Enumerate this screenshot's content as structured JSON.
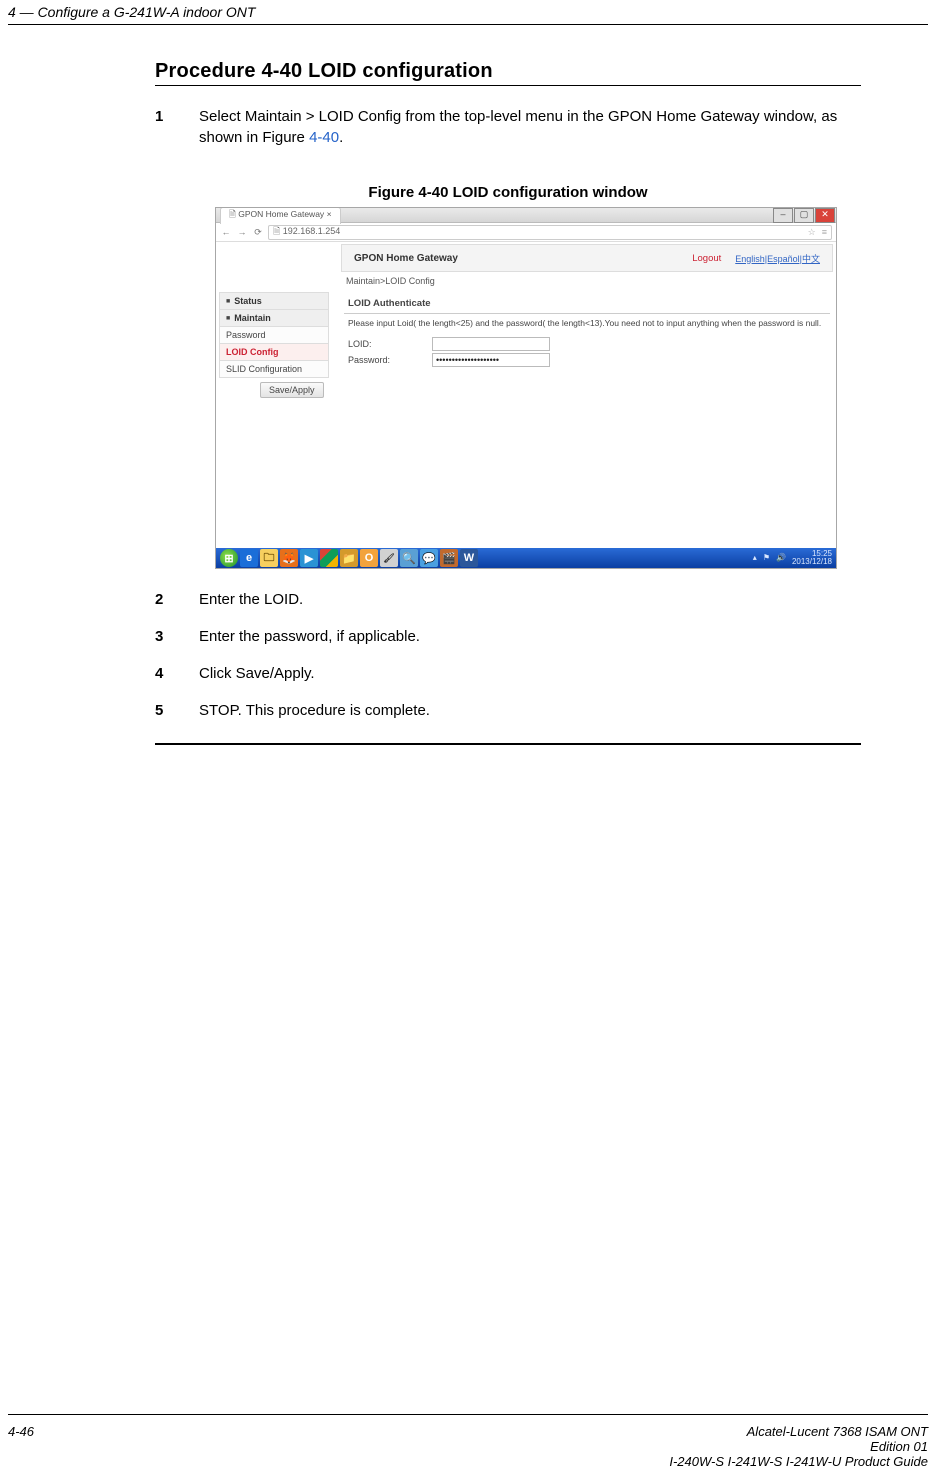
{
  "header": {
    "chapter_label": "4 — Configure a G-241W-A indoor ONT"
  },
  "procedure": {
    "title": "Procedure 4-40  LOID configuration",
    "steps": [
      {
        "num": "1",
        "text_before": "Select Maintain > LOID Config from the top-level menu in the GPON Home Gateway window, as shown in Figure ",
        "figref": "4-40",
        "text_after": "."
      },
      {
        "num": "2",
        "text": "Enter the LOID."
      },
      {
        "num": "3",
        "text": "Enter the password, if applicable."
      },
      {
        "num": "4",
        "text": "Click Save/Apply."
      },
      {
        "num": "5",
        "text": "STOP. This procedure is complete."
      }
    ],
    "figure_caption": "Figure 4-40  LOID configuration window"
  },
  "screenshot": {
    "tab_title": "GPON Home Gateway",
    "address": "192.168.1.254",
    "gw_title": "GPON Home Gateway",
    "logout": "Logout",
    "langs": "English|Español|中文",
    "breadcrumb": "Maintain>LOID Config",
    "sidebar": {
      "status": "Status",
      "maintain": "Maintain",
      "password": "Password",
      "loid": "LOID Config",
      "slid": "SLID Configuration"
    },
    "panel": {
      "title": "LOID Authenticate",
      "instruction": "Please input Loid( the length<25) and the password( the length<13).You need not to input anything when the password is null.",
      "loid_label": "LOID:",
      "password_label": "Password:",
      "password_value": "••••••••••••••••••••",
      "save_btn": "Save/Apply"
    },
    "taskbar": {
      "time": "15:25",
      "date": "2013/12/18"
    }
  },
  "footer": {
    "page": "4-46",
    "line1": "Alcatel-Lucent 7368 ISAM ONT",
    "line2": "Edition 01",
    "line3": "I-240W-S I-241W-S I-241W-U Product Guide"
  }
}
